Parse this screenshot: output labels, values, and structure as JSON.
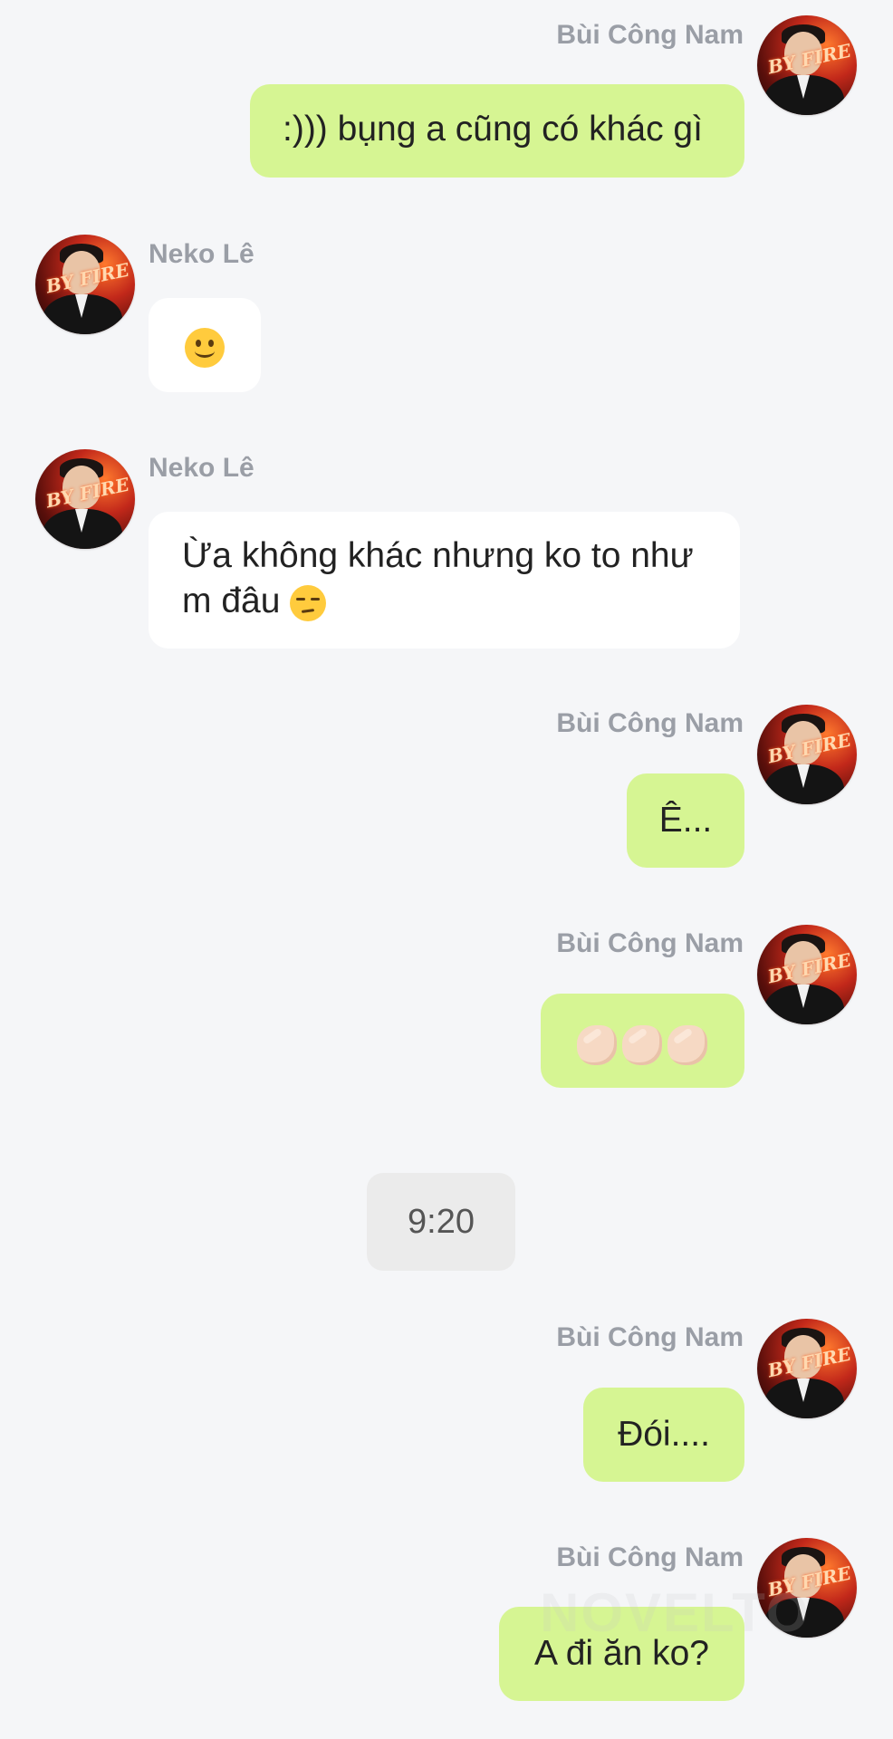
{
  "messages": [
    {
      "side": "right",
      "sender": "Bùi Công Nam",
      "text": ":))) bụng a cũng có khác gì"
    },
    {
      "side": "left",
      "sender": "Neko Lê",
      "text": "",
      "emoji": "slightly-smiling-face"
    },
    {
      "side": "left",
      "sender": "Neko Lê",
      "text_line1": "Ừa không khác nhưng ko to như",
      "text_line2": "m đâu",
      "emoji": "unamused-face"
    },
    {
      "side": "right",
      "sender": "Bùi Công Nam",
      "text": "Ê..."
    },
    {
      "side": "right",
      "sender": "Bùi Công Nam",
      "text": "",
      "emoji": "backhand-pointing-x3"
    },
    {
      "side": "right",
      "sender": "Bùi Công Nam",
      "text": "Đói...."
    },
    {
      "side": "right",
      "sender": "Bùi Công Nam",
      "text": "A đi ăn ko?"
    }
  ],
  "time_separator": "9:20",
  "avatar_caption": "BY FIRE",
  "watermark": "NOVELTO",
  "colors": {
    "background": "#f5f6f8",
    "outgoing_bubble": "#d6f593",
    "incoming_bubble": "#ffffff",
    "sender_name": "#9a9ea6",
    "time_pill": "#ebebeb"
  }
}
